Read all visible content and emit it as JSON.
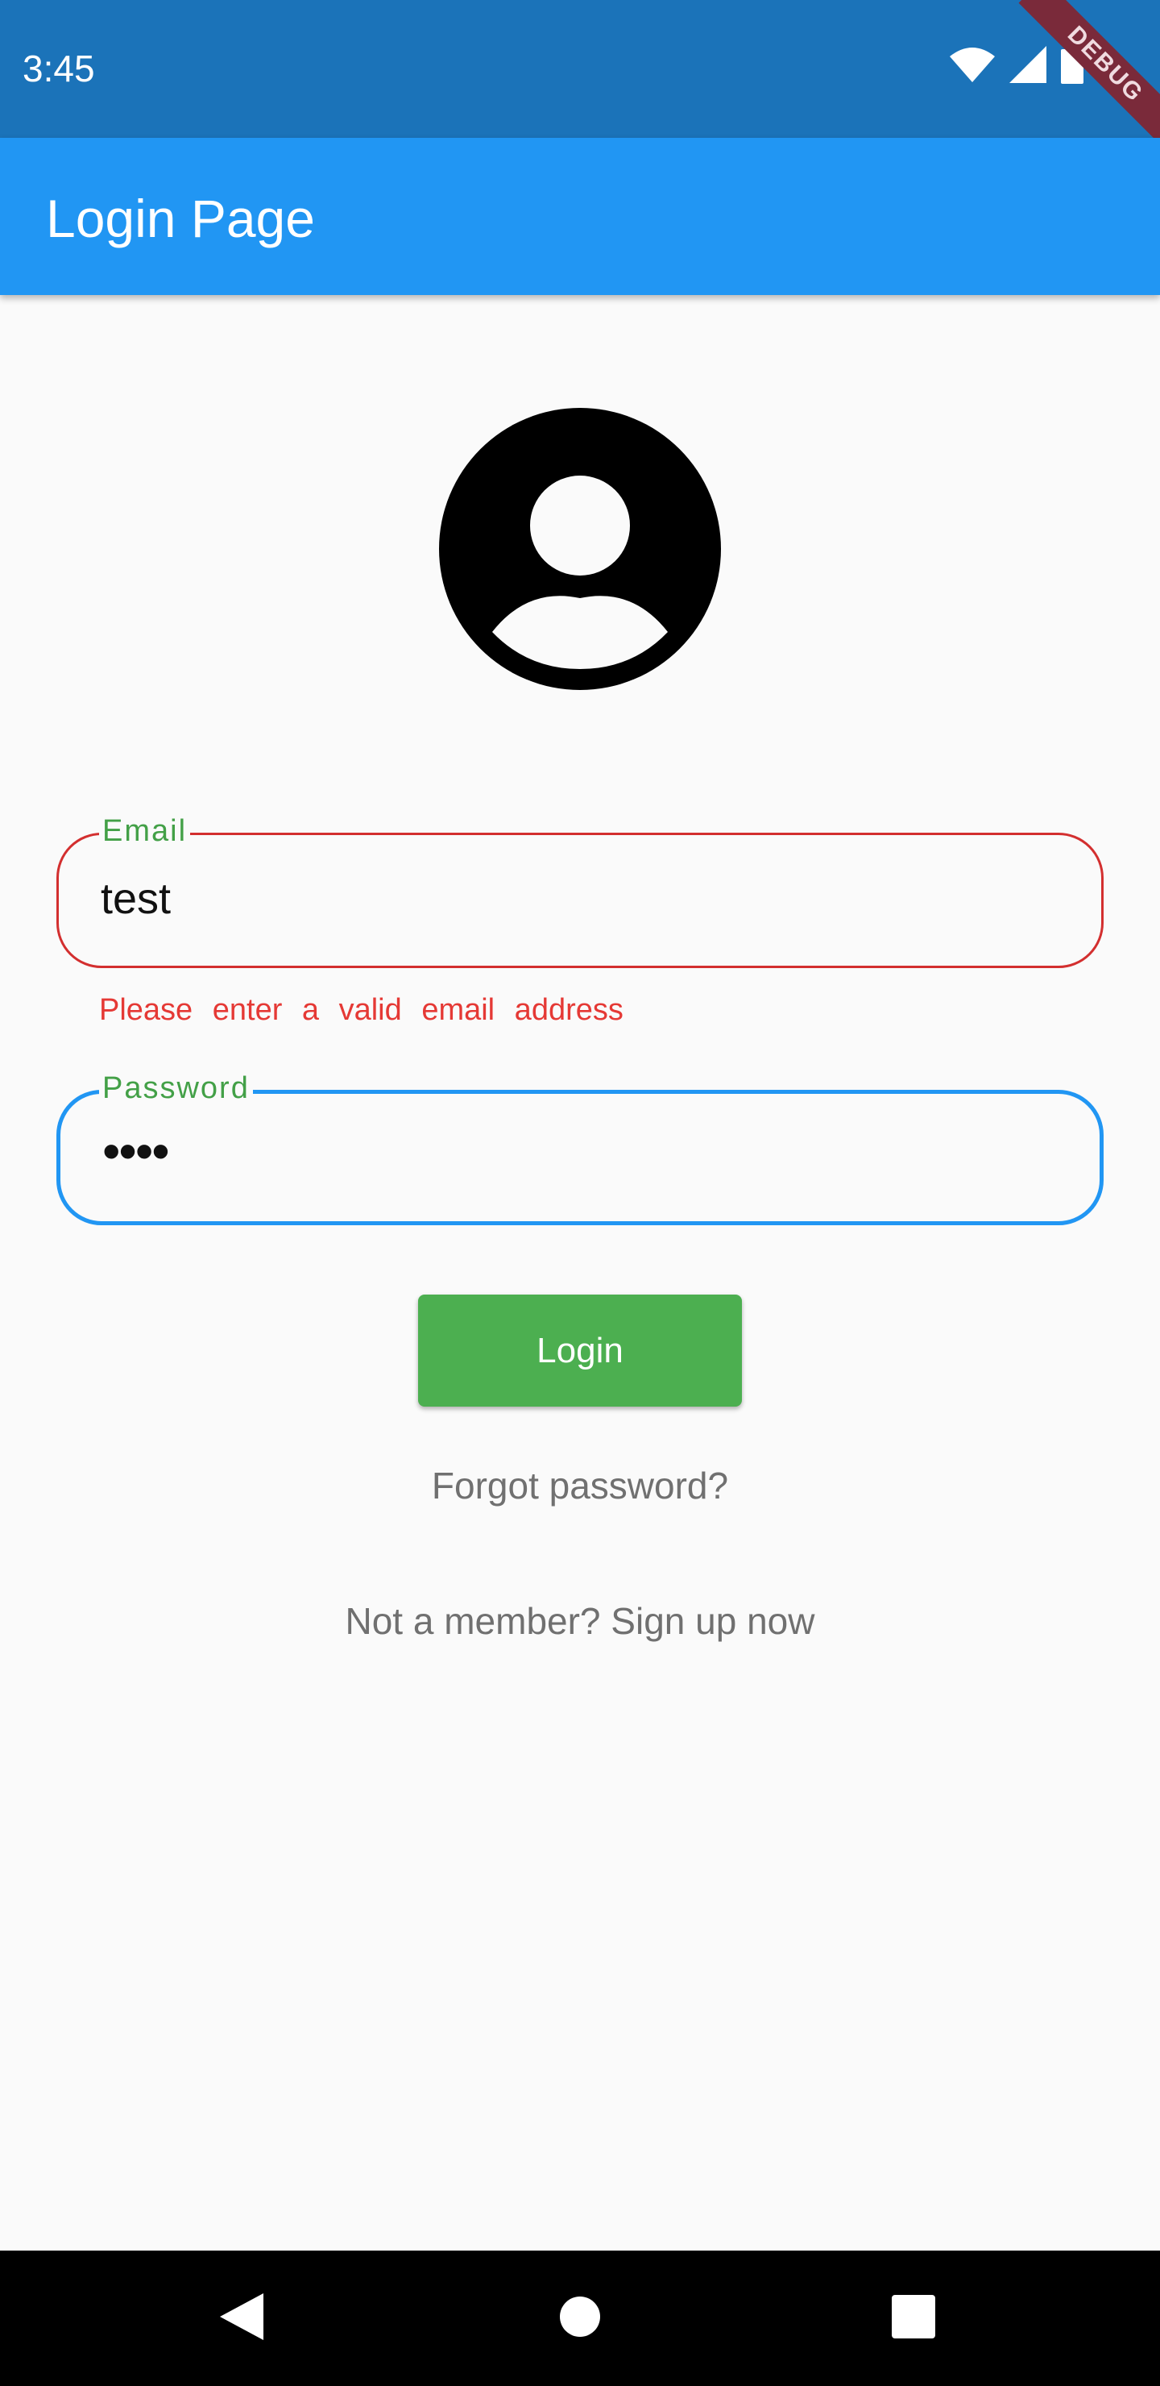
{
  "status_bar": {
    "time": "3:45",
    "icons": [
      "wifi-icon",
      "cell-signal-icon",
      "battery-icon"
    ]
  },
  "debug_banner": {
    "label": "DEBUG"
  },
  "app_bar": {
    "title": "Login Page",
    "color": "#2196f3"
  },
  "avatar": {
    "icon": "account-circle-icon"
  },
  "form": {
    "email": {
      "label": "Email",
      "value": "test",
      "error": "Please enter a valid email address",
      "border_color": "#d32f2f",
      "label_color": "#43a047"
    },
    "password": {
      "label": "Password",
      "value": "••••",
      "border_color": "#2196f3",
      "label_color": "#43a047"
    },
    "login_button": {
      "label": "Login",
      "color": "#4caf50"
    },
    "forgot_link": "Forgot password?",
    "signup_link": "Not a member? Sign up now"
  },
  "nav_bar": {
    "buttons": [
      "back-icon",
      "home-icon",
      "recents-icon"
    ]
  }
}
